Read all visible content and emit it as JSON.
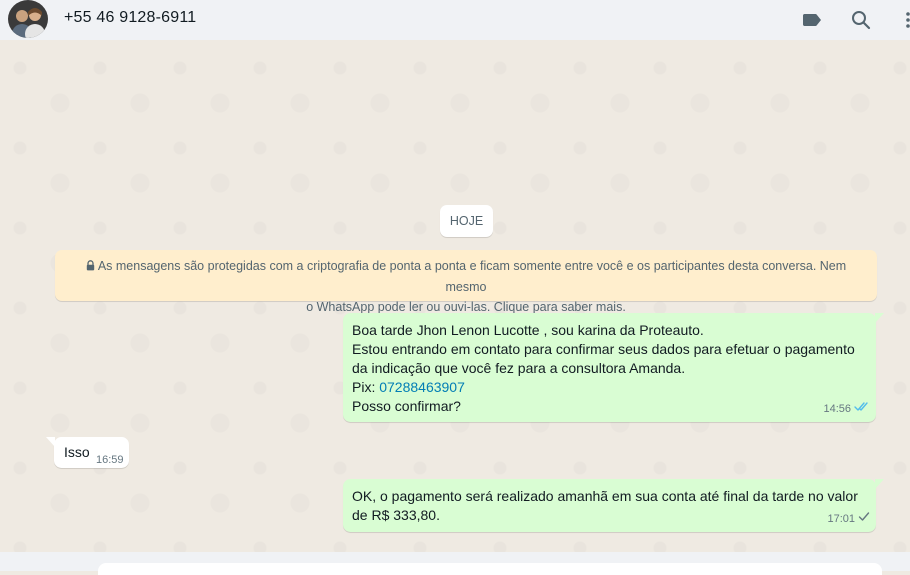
{
  "header": {
    "contact_name": "+55 46 9128-6911",
    "icons": [
      "label-icon",
      "search-icon",
      "menu-icon"
    ]
  },
  "chat": {
    "date_chip": "HOJE",
    "encryption_notice": {
      "line1": "As mensagens são protegidas com a criptografia de ponta a ponta e ficam somente entre você e os participantes desta conversa. Nem mesmo",
      "line2": "o WhatsApp pode ler ou ouvi-las. Clique para saber mais."
    },
    "messages": [
      {
        "direction": "outgoing",
        "lines": [
          "Boa tarde Jhon Lenon Lucotte  , sou karina da Proteauto.",
          "Estou entrando em contato para confirmar seus dados para efetuar o pagamento",
          "da indicação que você fez para a consultora Amanda."
        ],
        "pix_label": "Pix: ",
        "pix_value": "07288463907",
        "last_line": "Posso confirmar?",
        "time": "14:56",
        "status": "read"
      },
      {
        "direction": "incoming",
        "text": "Isso",
        "time": "16:59"
      },
      {
        "direction": "outgoing",
        "lines": [
          "OK, o pagamento será realizado  amanhã em sua conta até final da tarde no valor",
          "de R$ 333,80."
        ],
        "time": "17:01",
        "status": "sent"
      }
    ]
  },
  "colors": {
    "outgoing_bubble": "#d9fdd3",
    "incoming_bubble": "#ffffff",
    "notice_bg": "#ffeecd",
    "read_ticks": "#53bdeb",
    "link": "#027eb5"
  }
}
